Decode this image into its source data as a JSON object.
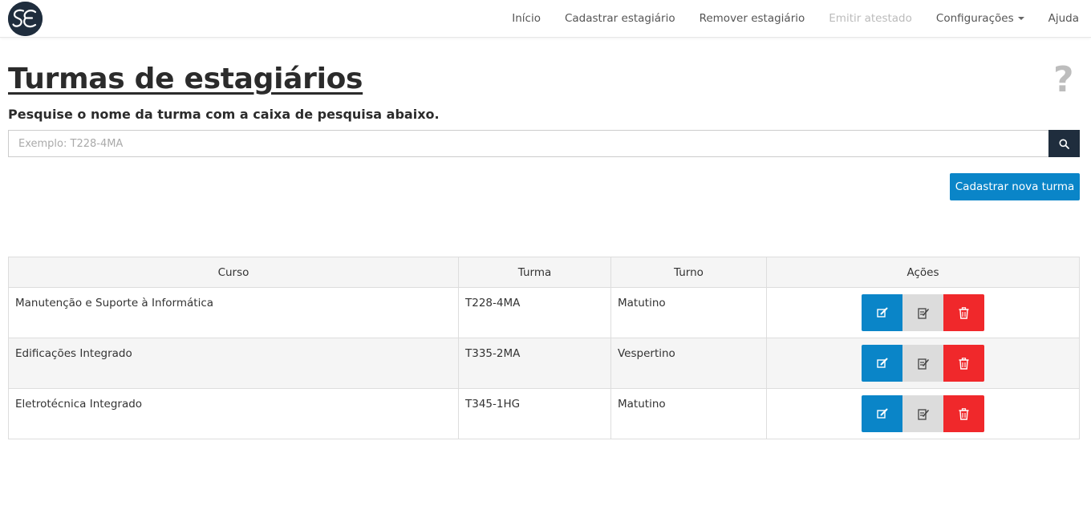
{
  "brand": {
    "logo_text": "SE"
  },
  "nav": {
    "items": [
      {
        "label": "Início",
        "disabled": false
      },
      {
        "label": "Cadastrar estagiário",
        "disabled": false
      },
      {
        "label": "Remover estagiário",
        "disabled": false
      },
      {
        "label": "Emitir atestado",
        "disabled": true
      },
      {
        "label": "Configurações",
        "disabled": false,
        "dropdown": true
      },
      {
        "label": "Ajuda",
        "disabled": false
      }
    ]
  },
  "page": {
    "title": "Turmas de estagiários",
    "subtitle": "Pesquise o nome da turma com a caixa de pesquisa abaixo.",
    "help_icon": "?"
  },
  "search": {
    "placeholder": "Exemplo: T228-4MA",
    "value": ""
  },
  "new_button": {
    "label": "Cadastrar nova turma"
  },
  "table": {
    "headers": [
      "Curso",
      "Turma",
      "Turno",
      "Ações"
    ],
    "rows": [
      {
        "curso": "Manutenção e Suporte à Informática",
        "turma": "T228-4MA",
        "turno": "Matutino"
      },
      {
        "curso": "Edificações Integrado",
        "turma": "T335-2MA",
        "turno": "Vespertino"
      },
      {
        "curso": "Eletrotécnica Integrado",
        "turma": "T345-1HG",
        "turno": "Matutino"
      }
    ]
  },
  "colors": {
    "primary": "#0a85c8",
    "danger": "#f0282b",
    "dark": "#1f2d3d",
    "neutral": "#dcdcdc"
  },
  "icons": {
    "search": "search-icon",
    "edit": "edit-icon",
    "notes": "notes-icon",
    "delete": "trash-icon"
  }
}
